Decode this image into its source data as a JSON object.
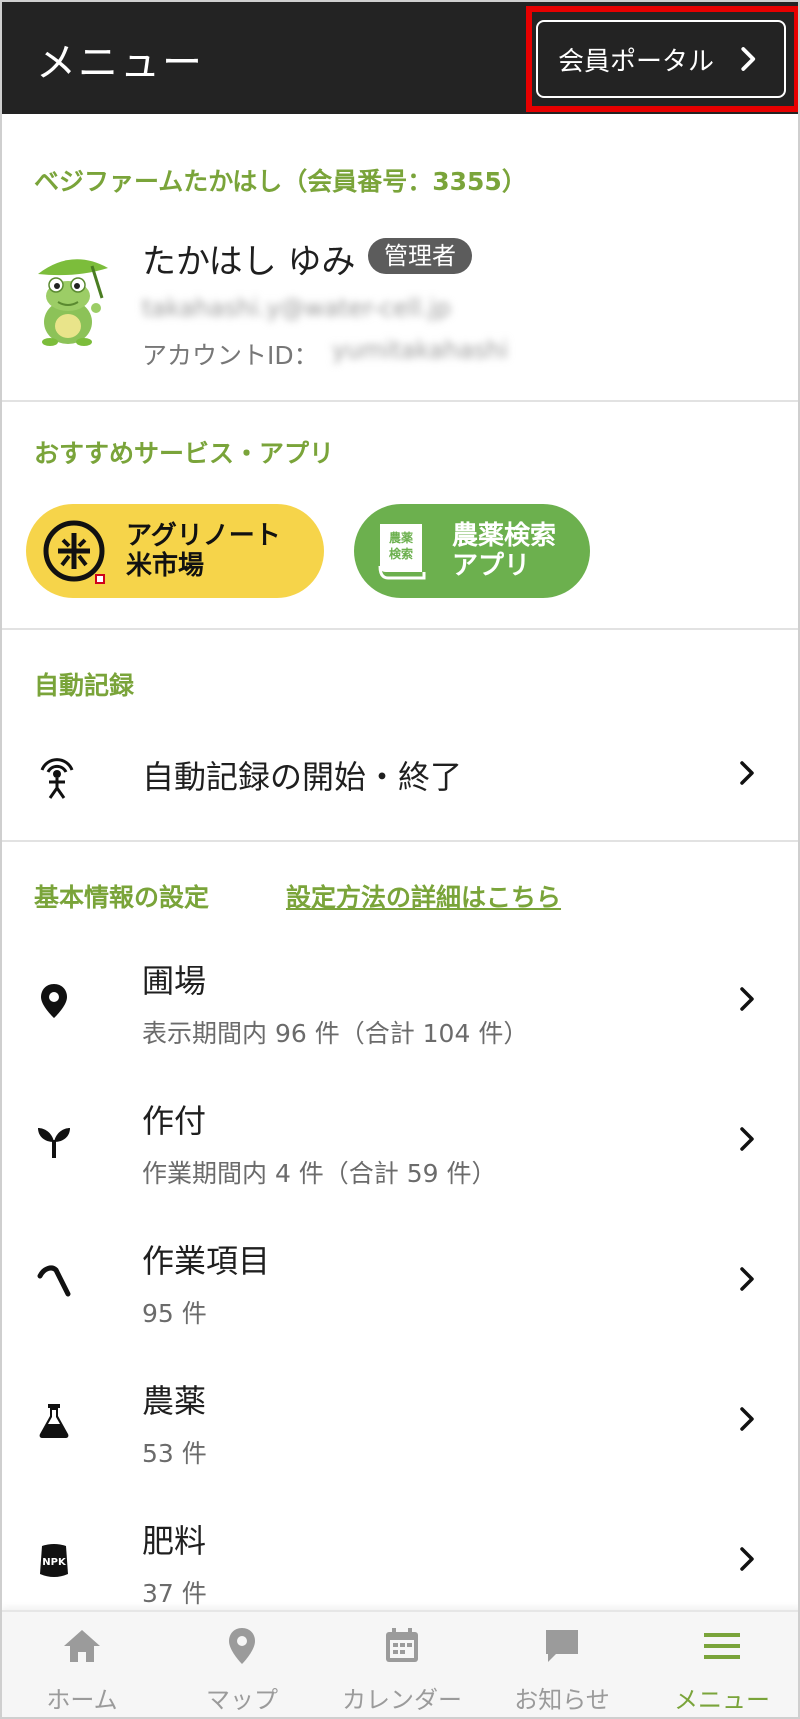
{
  "header": {
    "title": "メニュー",
    "portal_label": "会員ポータル"
  },
  "account": {
    "org": "ベジファームたかはし（会員番号：3355）",
    "name": "たかはし ゆみ",
    "role": "管理者",
    "email": "takahashi.y@water-cell.jp",
    "account_id_label": "アカウントID：",
    "account_id": "yumitakahashi"
  },
  "recommended": {
    "title": "おすすめサービス・アプリ",
    "apps": [
      {
        "line1": "アグリノート",
        "line2": "米市場"
      },
      {
        "line1": "農薬検索",
        "line2": "アプリ"
      }
    ],
    "green_icon_text": [
      "農薬",
      "検索"
    ]
  },
  "auto_record": {
    "title": "自動記録",
    "item": "自動記録の開始・終了"
  },
  "basic_settings": {
    "title": "基本情報の設定",
    "link": "設定方法の詳細はこちら",
    "items": [
      {
        "title": "圃場",
        "sub": "表示期間内 96 件（合計 104 件）"
      },
      {
        "title": "作付",
        "sub": "作業期間内 4 件（合計 59 件）"
      },
      {
        "title": "作業項目",
        "sub": "95 件"
      },
      {
        "title": "農薬",
        "sub": "53 件"
      },
      {
        "title": "肥料",
        "sub": "37 件"
      }
    ],
    "npk_text": "NPK"
  },
  "nav": {
    "items": [
      {
        "label": "ホーム"
      },
      {
        "label": "マップ"
      },
      {
        "label": "カレンダー"
      },
      {
        "label": "お知らせ"
      },
      {
        "label": "メニュー"
      }
    ],
    "active_index": 4
  },
  "colors": {
    "accent": "#7aa43a",
    "header_bg": "#232323",
    "highlight": "#e60000",
    "yellow_pill": "#f6d44a",
    "green_pill": "#6cb04e"
  }
}
